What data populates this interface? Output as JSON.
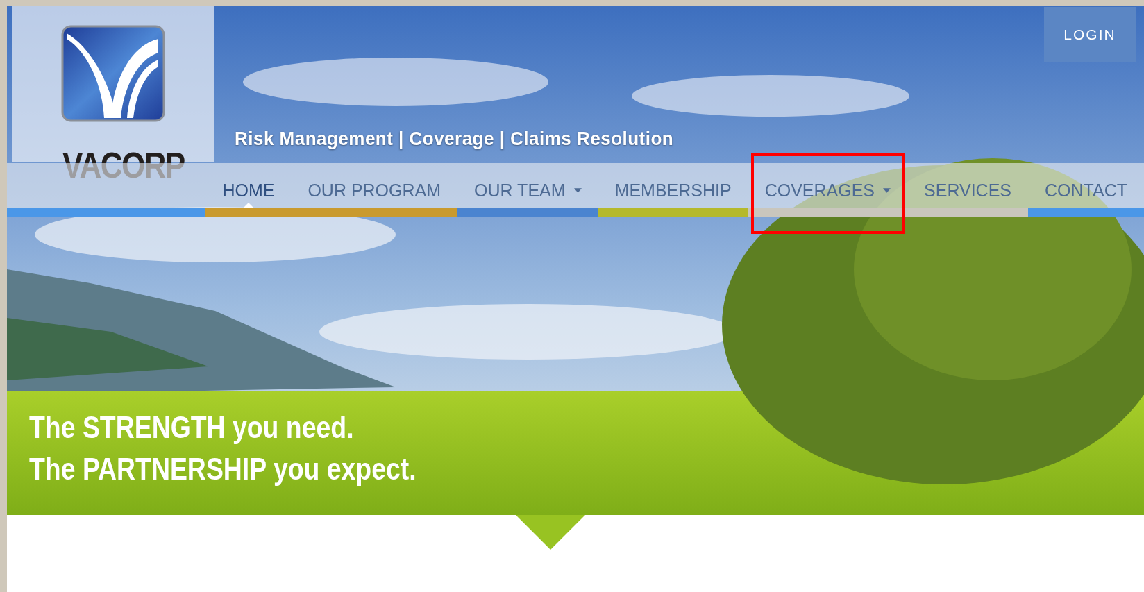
{
  "brand": {
    "name": "VACORP"
  },
  "login": {
    "label": "LOGIN"
  },
  "tagline": "Risk Management | Coverage | Claims Resolution",
  "nav": {
    "items": [
      {
        "label": "HOME",
        "selected": true,
        "dropdown": false,
        "highlighted": false,
        "color": "#c99a2e"
      },
      {
        "label": "OUR PROGRAM",
        "selected": false,
        "dropdown": false,
        "highlighted": false,
        "color": "#c99a2e"
      },
      {
        "label": "OUR TEAM",
        "selected": false,
        "dropdown": true,
        "highlighted": false,
        "color": "#4a84d0"
      },
      {
        "label": "MEMBERSHIP",
        "selected": false,
        "dropdown": false,
        "highlighted": false,
        "color": "#b5b92c"
      },
      {
        "label": "COVERAGES",
        "selected": false,
        "dropdown": true,
        "highlighted": true,
        "color": "#c9c6bd"
      },
      {
        "label": "SERVICES",
        "selected": false,
        "dropdown": false,
        "highlighted": false,
        "color": "#c9c6bd"
      },
      {
        "label": "CONTACT",
        "selected": false,
        "dropdown": false,
        "highlighted": false,
        "color": "#4a97e8"
      }
    ]
  },
  "headline": [
    "The STRENGTH you need.",
    "The PARTNERSHIP you expect."
  ]
}
